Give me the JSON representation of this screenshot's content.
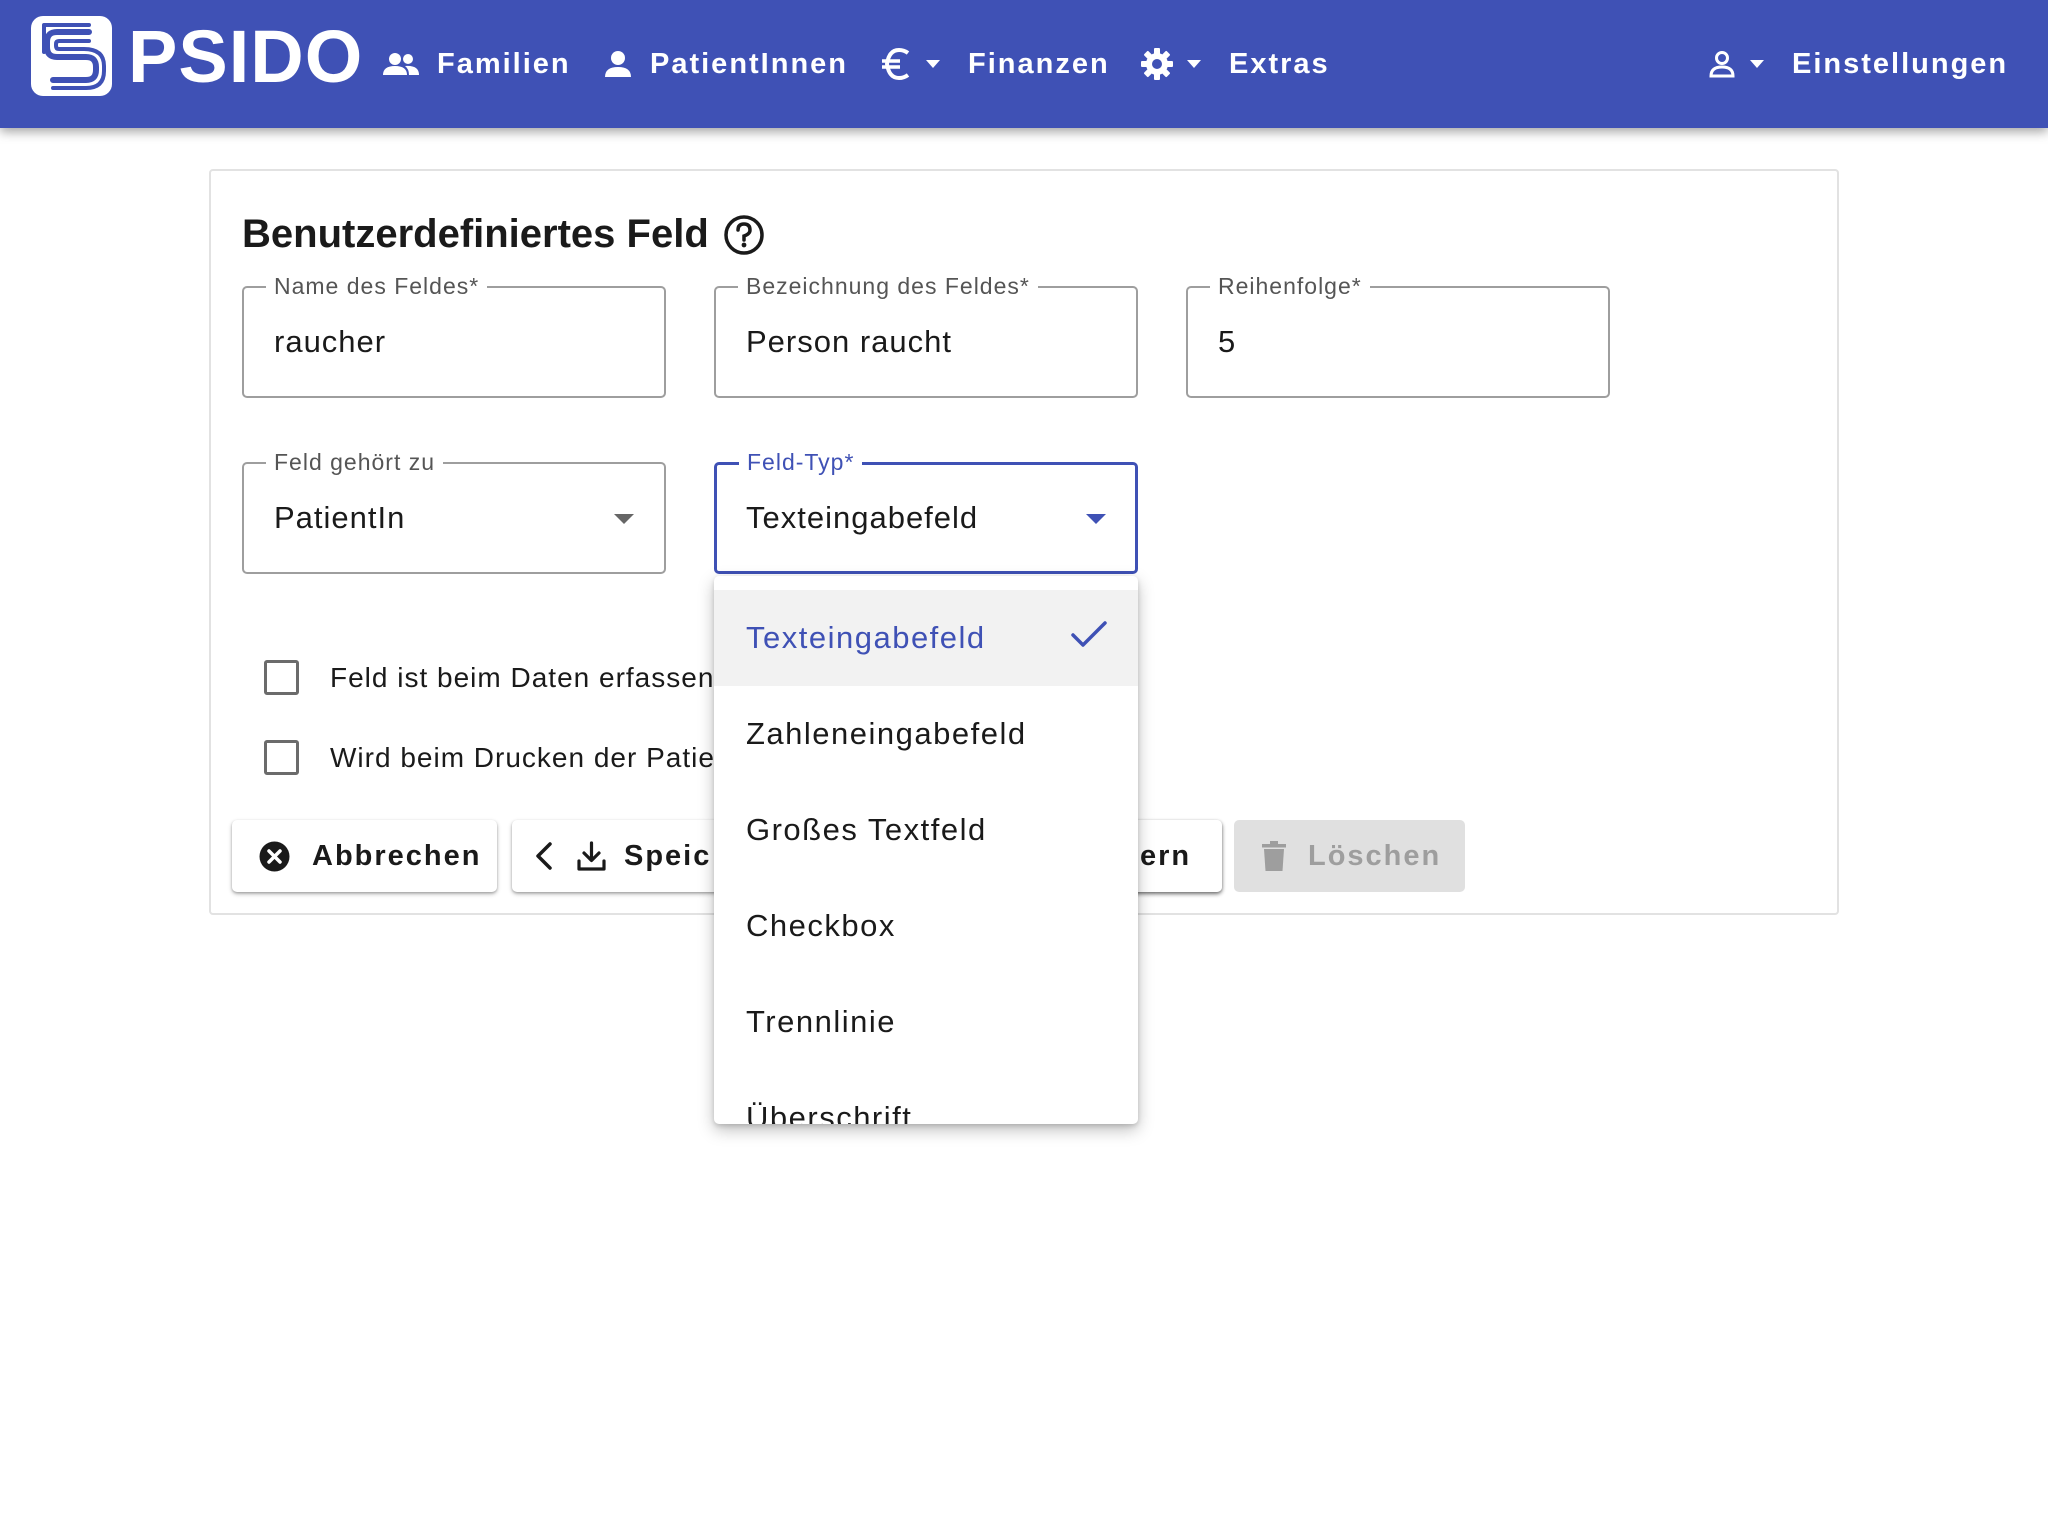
{
  "app": {
    "brand": "PSIDO",
    "logo_icon": "psido-logo-icon",
    "accent_color": "#3f51b5"
  },
  "nav": {
    "familien": "Familien",
    "patienten": "PatientInnen",
    "finanzen": "Finanzen",
    "extras": "Extras",
    "einstellungen": "Einstellungen"
  },
  "card": {
    "title": "Benutzerdefiniertes Feld"
  },
  "fields": {
    "name": {
      "label": "Name des Feldes*",
      "value": "raucher"
    },
    "bezeichnung": {
      "label": "Bezeichnung des Feldes*",
      "value": "Person raucht"
    },
    "reihenfolge": {
      "label": "Reihenfolge*",
      "value": "5"
    },
    "gehoert_zu": {
      "label": "Feld gehört zu",
      "value": "PatientIn"
    },
    "typ": {
      "label": "Feld-Typ*",
      "value": "Texteingabefeld"
    }
  },
  "checkboxes": {
    "required": {
      "label": "Feld ist beim Daten erfassen l",
      "checked": false
    },
    "print": {
      "label": "Wird beim Drucken der Patient",
      "checked": false
    }
  },
  "buttons": {
    "cancel": "Abbrechen",
    "save_back": "Speic",
    "save": "ern",
    "delete": "Löschen"
  },
  "dropdown": {
    "options": [
      {
        "label": "Texteingabefeld",
        "selected": true
      },
      {
        "label": "Zahleneingabefeld",
        "selected": false
      },
      {
        "label": "Großes Textfeld",
        "selected": false
      },
      {
        "label": "Checkbox",
        "selected": false
      },
      {
        "label": "Trennlinie",
        "selected": false
      },
      {
        "label": "Überschrift",
        "selected": false
      }
    ]
  }
}
